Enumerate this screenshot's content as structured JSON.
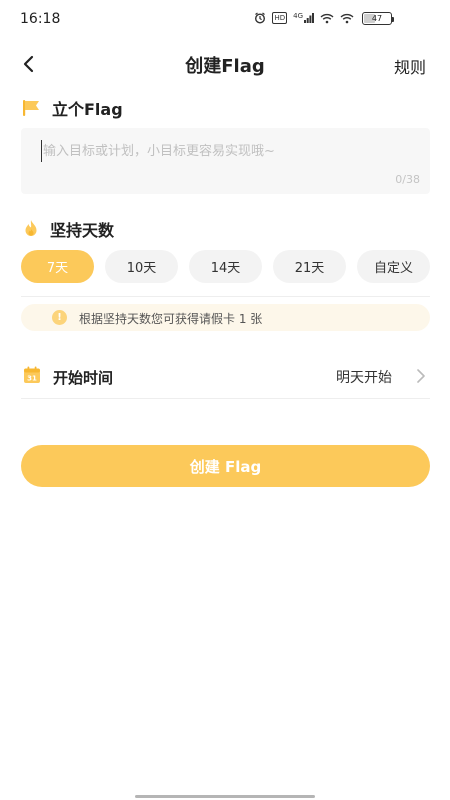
{
  "status_bar": {
    "time": "16:18",
    "network_label": "4G",
    "hd_label": "HD",
    "battery": "47",
    "battery_level": 0.47
  },
  "nav": {
    "title": "创建Flag",
    "rules_label": "规则"
  },
  "goal_section": {
    "title": "立个Flag",
    "placeholder": "输入目标或计划，小目标更容易实现哦~",
    "value": "",
    "counter": "0/38"
  },
  "days_section": {
    "title": "坚持天数",
    "options": [
      "7天",
      "10天",
      "14天",
      "21天",
      "自定义"
    ],
    "selected": "7天"
  },
  "tip": {
    "icon": "!",
    "text": "根据坚持天数您可获得请假卡 1 张"
  },
  "start_section": {
    "icon_text": "31",
    "label": "开始时间",
    "value": "明天开始"
  },
  "create_button": {
    "label": "创建 Flag"
  },
  "colors": {
    "accent": "#fcc95a",
    "chip_bg": "#f3f3f3",
    "tip_bg": "#fdf7ea",
    "input_bg": "#f7f7f7"
  }
}
